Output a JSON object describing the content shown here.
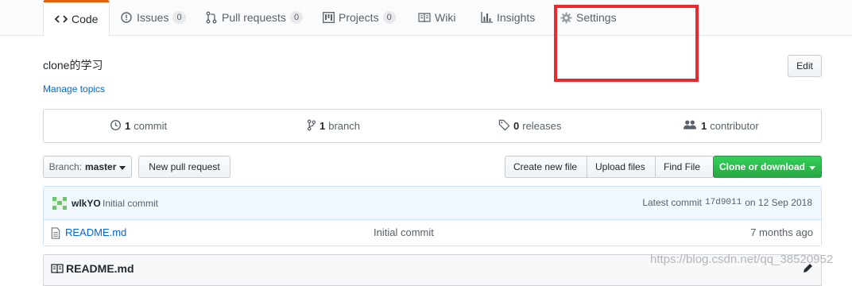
{
  "tabs": {
    "code": {
      "label": "Code"
    },
    "issues": {
      "label": "Issues",
      "count": "0"
    },
    "pulls": {
      "label": "Pull requests",
      "count": "0"
    },
    "projects": {
      "label": "Projects",
      "count": "0"
    },
    "wiki": {
      "label": "Wiki"
    },
    "insights": {
      "label": "Insights"
    },
    "settings": {
      "label": "Settings"
    }
  },
  "repo": {
    "description": "clone的学习",
    "manage_topics": "Manage topics",
    "edit_label": "Edit"
  },
  "summary": {
    "commits": {
      "count": "1",
      "label": "commit"
    },
    "branches": {
      "count": "1",
      "label": "branch"
    },
    "releases": {
      "count": "0",
      "label": "releases"
    },
    "contributors": {
      "count": "1",
      "label": "contributor"
    }
  },
  "file_nav": {
    "branch_prefix": "Branch:",
    "branch_name": "master",
    "new_pull_request": "New pull request",
    "create_new_file": "Create new file",
    "upload_files": "Upload files",
    "find_file": "Find File",
    "clone_or_download": "Clone or download"
  },
  "latest_commit": {
    "author": "wlkYO",
    "message": "Initial commit",
    "prefix": "Latest commit",
    "sha": "17d9011",
    "date": "on 12 Sep 2018"
  },
  "files": [
    {
      "name": "README.md",
      "message": "Initial commit",
      "age": "7 months ago"
    }
  ],
  "readme": {
    "title": "README.md"
  },
  "watermark": "https://blog.csdn.net/qq_38520952",
  "colors": {
    "accent_tab": "#e36209",
    "link": "#0366d6",
    "highlight": "#ee2a2f",
    "green_button": "#28a745"
  }
}
